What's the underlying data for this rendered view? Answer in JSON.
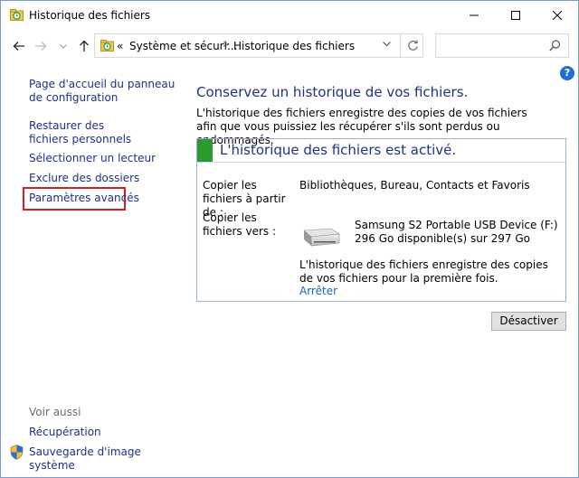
{
  "window": {
    "title": "Historique des fichiers"
  },
  "navigation": {
    "breadcrumb_prefix": "«",
    "breadcrumb": [
      "Système et sécuri...",
      "Historique des fichiers"
    ],
    "search_placeholder": ""
  },
  "sidebar": {
    "links": [
      "Page d'accueil du panneau de configuration",
      "Restaurer des fichiers personnels",
      "Sélectionner un lecteur",
      "Exclure des dossiers",
      "Paramètres avancés"
    ],
    "see_also_title": "Voir aussi",
    "see_also": [
      "Récupération",
      "Sauvegarde d'image système"
    ]
  },
  "main": {
    "heading": "Conservez un historique de vos fichiers.",
    "description": "L'historique des fichiers enregistre des copies de vos fichiers afin que vous puissiez les récupérer s'ils sont perdus ou endommagés.",
    "status": "L'historique des fichiers est activé.",
    "copy_from_label": "Copier les fichiers à partir de :",
    "copy_from_value": "Bibliothèques, Bureau, Contacts et Favoris",
    "copy_to_label": "Copier les fichiers vers :",
    "drive_name": "Samsung S2 Portable USB Device (F:)",
    "drive_space": "296 Go disponible(s) sur 297 Go",
    "info": "L'historique des fichiers enregistre des copies de vos fichiers pour la première fois.",
    "stop_link": "Arrêter",
    "deactivate_button": "Désactiver"
  },
  "colors": {
    "link": "#1e3287",
    "status_green": "#2d9a2d",
    "highlight_box": "#d01f25",
    "help": "#1d6fd1"
  }
}
